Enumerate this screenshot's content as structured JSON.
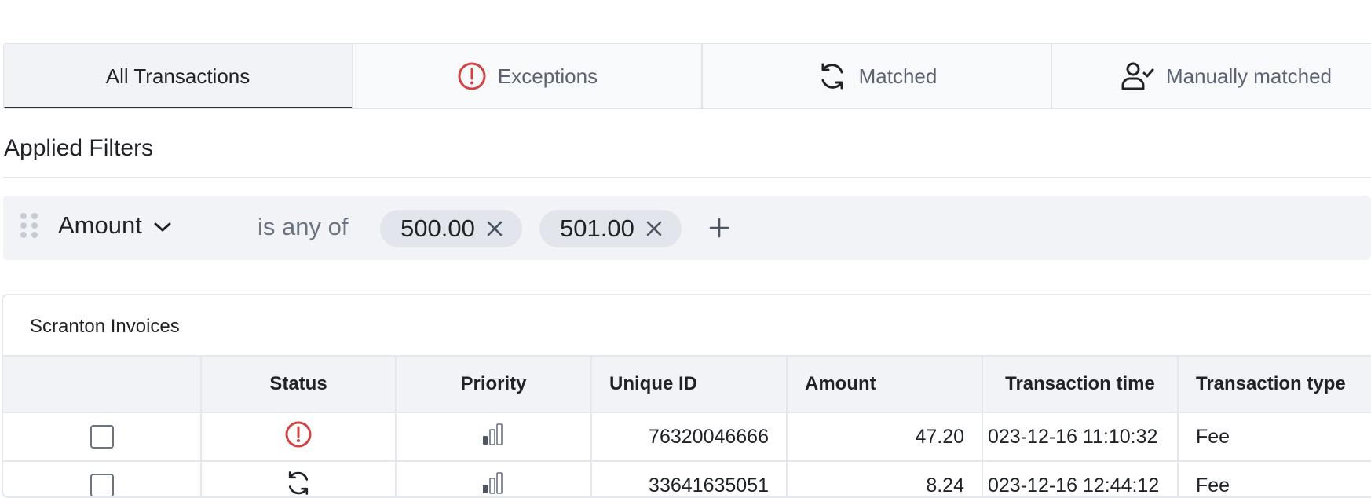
{
  "tabs": [
    {
      "label": "All Transactions",
      "icon": "",
      "active": true
    },
    {
      "label": "Exceptions",
      "icon": "exclamation-circle-icon",
      "active": false
    },
    {
      "label": "Matched",
      "icon": "refresh-icon",
      "active": false
    },
    {
      "label": "Manually matched",
      "icon": "user-check-icon",
      "active": false
    }
  ],
  "filters": {
    "title": "Applied Filters",
    "field": "Amount",
    "operator": "is any of",
    "values": [
      "500.00",
      "501.00"
    ]
  },
  "table": {
    "title": "Scranton Invoices",
    "columns": [
      "Status",
      "Priority",
      "Unique ID",
      "Amount",
      "Transaction time",
      "Transaction type"
    ],
    "rows": [
      {
        "status_icon": "exclamation-circle-icon",
        "priority_icon": "signal-low-icon",
        "unique_id": "76320046666",
        "amount": "47.20",
        "time": "023-12-16 11:10:32",
        "type": "Fee"
      },
      {
        "status_icon": "refresh-icon",
        "priority_icon": "signal-low-icon",
        "unique_id": "33641635051",
        "amount": "8.24",
        "time": "023-12-16 12:44:12",
        "type": "Fee"
      }
    ]
  },
  "colors": {
    "exception_red": "#d14343",
    "text": "#1f2328",
    "muted": "#5b6270",
    "border": "#e4e7ec",
    "surface": "#f1f3f7"
  }
}
